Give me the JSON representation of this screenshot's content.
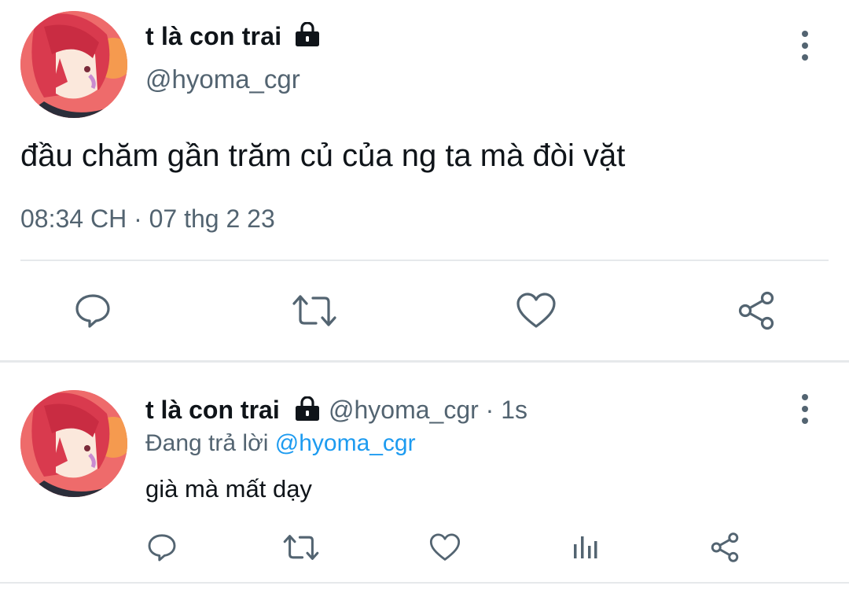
{
  "main_tweet": {
    "display_name": "t là con trai",
    "handle": "@hyoma_cgr",
    "text": "đầu chăm gần trăm củ của ng ta mà đòi vặt",
    "timestamp": "08:34 CH · 07 thg 2 23",
    "icons": {
      "lock": "lock-icon",
      "more": "more-vertical-icon",
      "reply": "reply-icon",
      "retweet": "retweet-icon",
      "like": "heart-icon",
      "share": "share-icon"
    }
  },
  "reply_tweet": {
    "display_name": "t là con trai",
    "handle_time": "@hyoma_cgr · 1s",
    "replying_prefix": "Đang trả lời ",
    "replying_to": "@hyoma_cgr",
    "text": "già mà mất dạy",
    "icons": {
      "lock": "lock-icon",
      "more": "more-vertical-icon",
      "reply": "reply-icon",
      "retweet": "retweet-icon",
      "like": "heart-icon",
      "views": "analytics-icon",
      "share": "share-icon"
    }
  },
  "colors": {
    "text_primary": "#0f1419",
    "text_secondary": "#536471",
    "link": "#1d9bf0",
    "divider": "#e6e9eb"
  }
}
